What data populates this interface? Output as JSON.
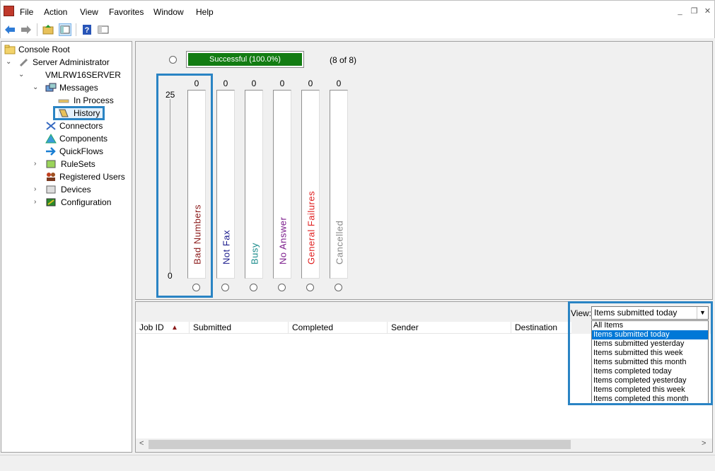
{
  "menu": [
    "File",
    "Action",
    "View",
    "Favorites",
    "Window",
    "Help"
  ],
  "window_buttons": {
    "minimize": "_",
    "restore": "❐",
    "close": "✕"
  },
  "toolbar_icons": [
    "back-arrow-icon",
    "forward-arrow-icon",
    "up-folder-icon",
    "show-hide-tree-icon",
    "help-icon",
    "properties-icon"
  ],
  "tree": {
    "console_root": "Console Root",
    "server_admin": "Server Administrator",
    "server": "VMLRW16SERVER",
    "messages": "Messages",
    "in_process": "In Process",
    "history": "History",
    "connectors": "Connectors",
    "components": "Components",
    "quickflows": "QuickFlows",
    "rulesets": "RuleSets",
    "registered_users": "Registered Users",
    "devices": "Devices",
    "configuration": "Configuration"
  },
  "status": {
    "successful_label": "Successful (100.0%)",
    "successful_fraction": 1.0,
    "count_text": "(8 of 8)",
    "scale_max": "25",
    "scale_min": "0",
    "columns": [
      {
        "label": "Bad Numbers",
        "value": "0",
        "color": "#8b1a1a"
      },
      {
        "label": "Not Fax",
        "value": "0",
        "color": "#1a1a8b"
      },
      {
        "label": "Busy",
        "value": "0",
        "color": "#1a8b8b"
      },
      {
        "label": "No Answer",
        "value": "0",
        "color": "#7a1a8b"
      },
      {
        "label": "General Failures",
        "value": "0",
        "color": "#e02020"
      },
      {
        "label": "Cancelled",
        "value": "0",
        "color": "#8a8a8a"
      }
    ]
  },
  "view": {
    "label": "View:",
    "selected": "Items submitted today",
    "options": [
      "All Items",
      "Items submitted today",
      "Items submitted yesterday",
      "Items submitted this week",
      "Items submitted this month",
      "Items completed today",
      "Items completed yesterday",
      "Items completed this week",
      "Items completed this month"
    ]
  },
  "list": {
    "columns": [
      "Job ID",
      "Submitted",
      "Completed",
      "Sender",
      "Destination"
    ]
  }
}
